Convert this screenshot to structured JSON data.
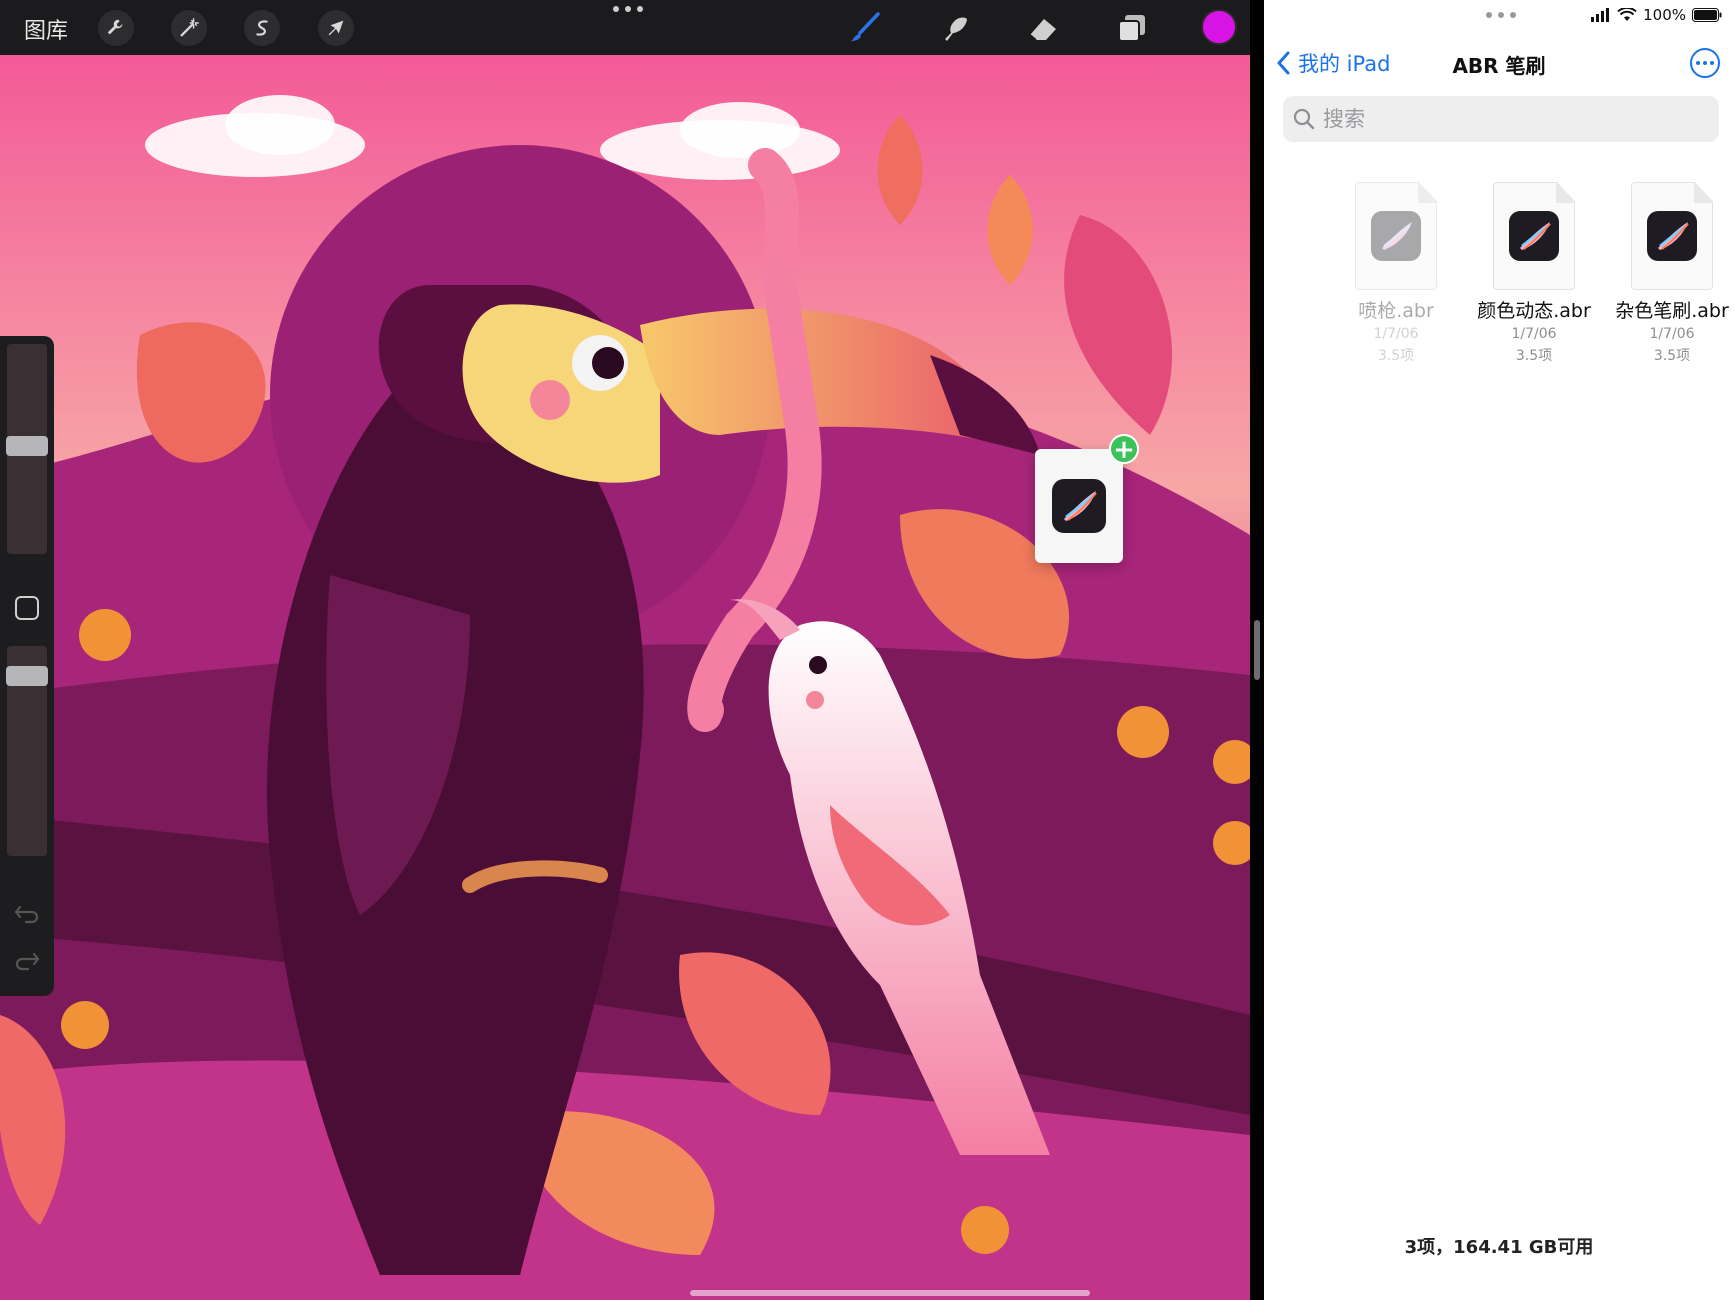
{
  "procreate": {
    "gallery_label": "图库",
    "tools": {
      "adjustments_icon": "wrench-icon",
      "magic_icon": "magic-wand-icon",
      "selection_icon": "selection-s-icon",
      "transform_icon": "arrow-cursor-icon",
      "paint_icon": "brush-icon",
      "smudge_icon": "smudge-icon",
      "eraser_icon": "eraser-icon",
      "layers_icon": "layers-icon"
    },
    "current_color": "#d813e6"
  },
  "files": {
    "status": {
      "battery": "100%"
    },
    "back_label": "我的 iPad",
    "title": "ABR 笔刷",
    "search_placeholder": "搜索",
    "items": [
      {
        "name": "喷枪.abr",
        "date": "1/7/06",
        "size": "3.5项"
      },
      {
        "name": "颜色动态.abr",
        "date": "1/7/06",
        "size": "3.5项"
      },
      {
        "name": "杂色笔刷.abr",
        "date": "1/7/06",
        "size": "3.5项"
      }
    ],
    "footer": "3项，164.41 GB可用"
  },
  "colors": {
    "accent_blue": "#1a73e8",
    "add_badge_green": "#3cc25a",
    "toolbar_bg": "#1b1b1d"
  }
}
